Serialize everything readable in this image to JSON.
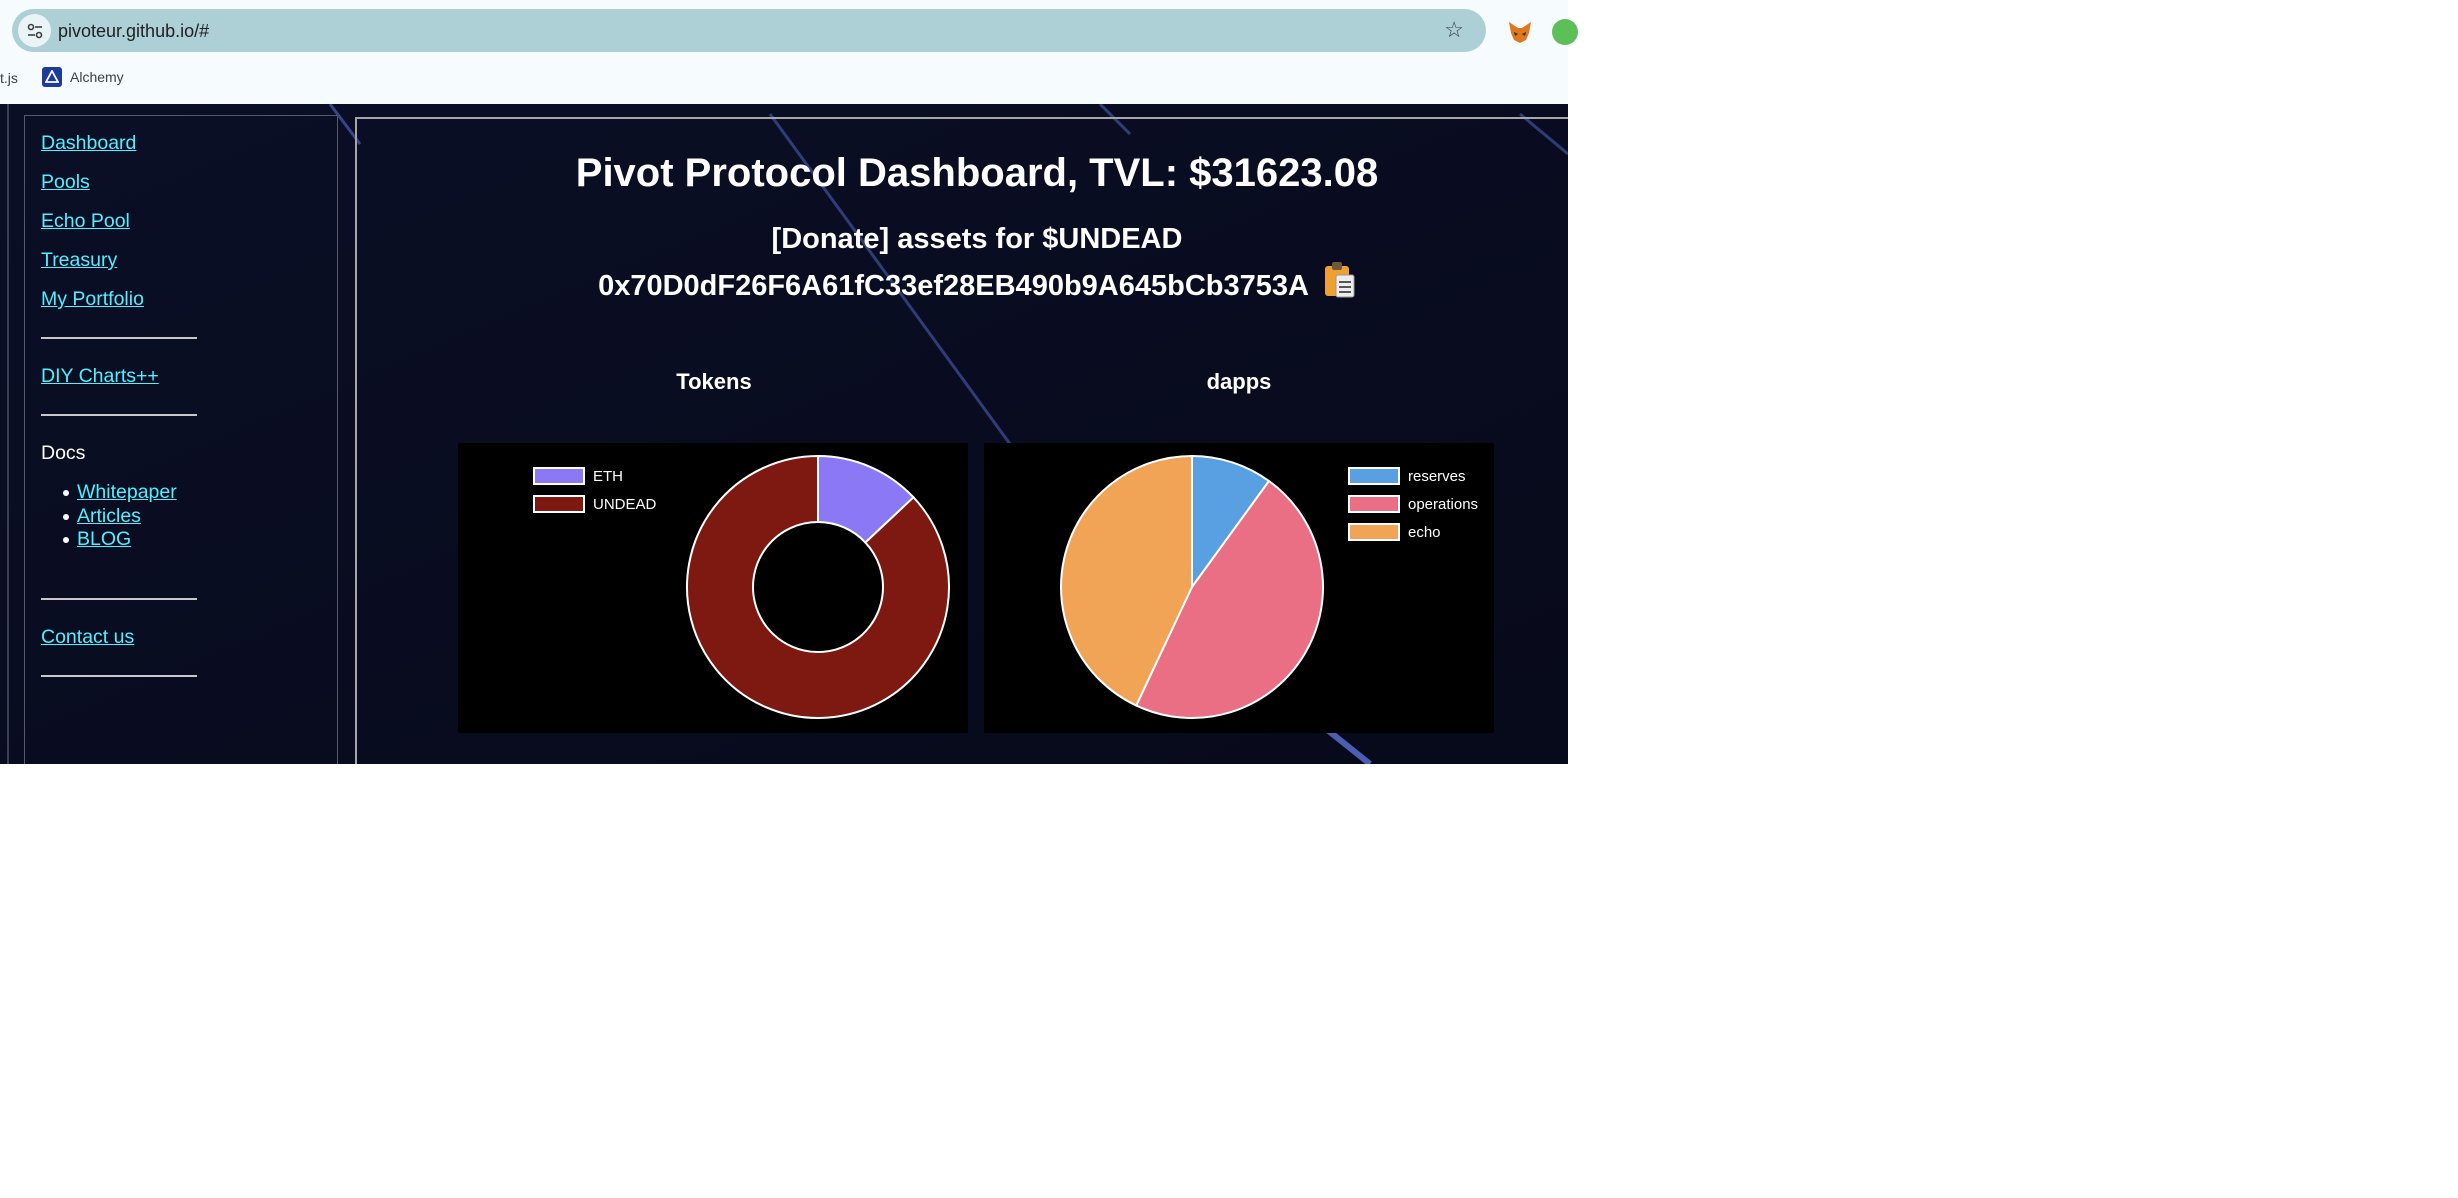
{
  "browser": {
    "url": "pivoteur.github.io/#",
    "bookmarks": [
      {
        "label": "t.js"
      },
      {
        "label": "Alchemy"
      }
    ]
  },
  "sidebar": {
    "nav": [
      {
        "label": "Dashboard"
      },
      {
        "label": "Pools"
      },
      {
        "label": "Echo Pool"
      },
      {
        "label": "Treasury"
      },
      {
        "label": "My Portfolio"
      }
    ],
    "diy_label": "DIY Charts++",
    "docs_label": "Docs",
    "docs_items": [
      {
        "label": "Whitepaper"
      },
      {
        "label": "Articles"
      },
      {
        "label": "BLOG"
      }
    ],
    "contact_label": "Contact us"
  },
  "main": {
    "headline": "Pivot Protocol Dashboard, TVL: $31623.08",
    "donate_text": "[Donate] assets for $UNDEAD",
    "address": "0x70D0dF26F6A61fC33ef28EB490b9A645bCb3753A"
  },
  "colors": {
    "link": "#4ff0ff",
    "page_bg": "#090c1f",
    "eth": "#8b78f5",
    "undead": "#7e1912",
    "reserves": "#58a0e1",
    "operations": "#ea6e84",
    "echo": "#f1a456"
  },
  "chart_data": [
    {
      "type": "pie",
      "variant": "doughnut",
      "title": "Tokens",
      "categories": [
        "ETH",
        "UNDEAD"
      ],
      "values": [
        13,
        87
      ],
      "colors": [
        "#8b78f5",
        "#7e1912"
      ],
      "legend": "top-left"
    },
    {
      "type": "pie",
      "title": "dapps",
      "categories": [
        "reserves",
        "operations",
        "echo"
      ],
      "values": [
        10,
        47,
        43
      ],
      "colors": [
        "#58a0e1",
        "#ea6e84",
        "#f1a456"
      ],
      "legend": "top-right"
    }
  ]
}
